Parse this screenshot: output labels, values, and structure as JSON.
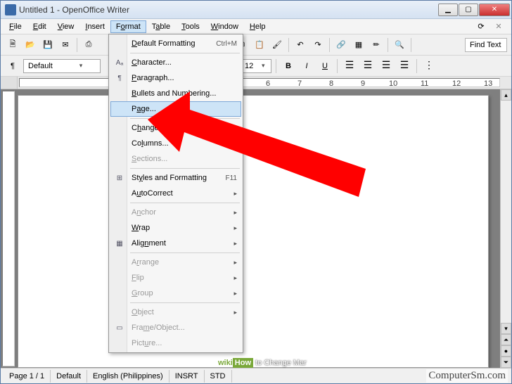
{
  "window": {
    "title": "Untitled 1 - OpenOffice Writer"
  },
  "menubar": {
    "items": [
      {
        "label": "File",
        "u": 0
      },
      {
        "label": "Edit",
        "u": 0
      },
      {
        "label": "View",
        "u": 0
      },
      {
        "label": "Insert",
        "u": 0
      },
      {
        "label": "Format",
        "u": 1,
        "active": true
      },
      {
        "label": "Table",
        "u": 0
      },
      {
        "label": "Tools",
        "u": 0
      },
      {
        "label": "Window",
        "u": 0
      },
      {
        "label": "Help",
        "u": 0
      }
    ]
  },
  "toolbar": {
    "find_label": "Find Text"
  },
  "formatbar": {
    "style": "Default",
    "font_size": "12",
    "bold": "B",
    "italic": "I",
    "underline": "U"
  },
  "ruler": {
    "ticks": [
      "6",
      "7",
      "8",
      "9",
      "10",
      "11",
      "12",
      "13"
    ]
  },
  "dropdown": {
    "default_formatting": "Default Formatting",
    "default_formatting_sc": "Ctrl+M",
    "character": "Character...",
    "paragraph": "Paragraph...",
    "bullets": "Bullets and Numbering...",
    "page": "Page...",
    "change_case": "Change Case",
    "columns": "Columns...",
    "sections": "Sections...",
    "styles": "Styles and Formatting",
    "styles_sc": "F11",
    "autocorrect": "AutoCorrect",
    "anchor": "Anchor",
    "wrap": "Wrap",
    "alignment": "Alignment",
    "arrange": "Arrange",
    "flip": "Flip",
    "group": "Group",
    "object": "Object",
    "frame": "Frame/Object...",
    "picture": "Picture..."
  },
  "status": {
    "page": "Page 1 / 1",
    "style": "Default",
    "lang": "English (Philippines)",
    "insrt": "INSRT",
    "std": "STD"
  },
  "watermark": {
    "wiki": "wiki",
    "how": "How",
    "caption": " to Change Mar",
    "site": "ComputerSm.com"
  }
}
